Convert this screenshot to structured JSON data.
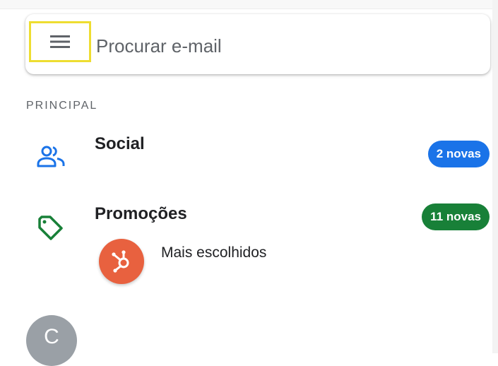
{
  "search": {
    "placeholder": "Procurar e-mail"
  },
  "sections": [
    {
      "label": "PRINCIPAL",
      "categories": [
        {
          "title": "Social",
          "icon": "people-icon",
          "badge": "2 novas",
          "badge_color": "#1a73e8"
        },
        {
          "title": "Promoções",
          "icon": "tag-icon",
          "badge": "11 novas",
          "badge_color": "#188038",
          "sender": {
            "name": "Mais escolhidos",
            "avatar_icon": "hubspot-logo-icon",
            "avatar_color": "#e8613f"
          }
        }
      ]
    }
  ],
  "account": {
    "initial": "C",
    "avatar_color": "#9aa0a6"
  },
  "colors": {
    "highlight": "#eedd31",
    "text": "#202124",
    "muted": "#5f6368"
  }
}
